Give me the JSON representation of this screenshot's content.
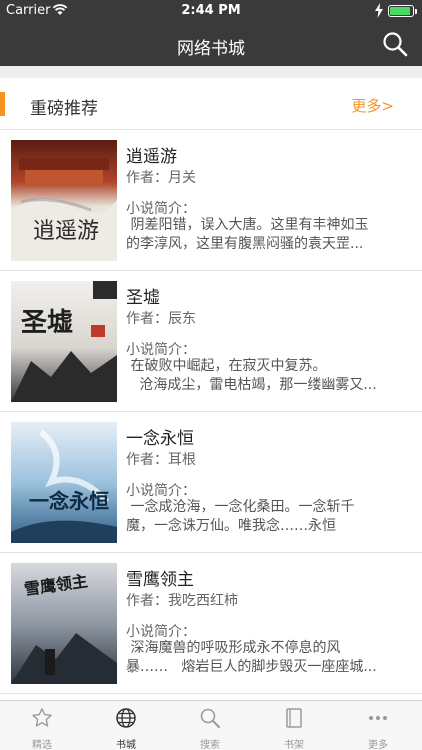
{
  "status_bar": {
    "carrier": "Carrier",
    "time": "2:44 PM",
    "battery_color": "#4cd964"
  },
  "nav": {
    "title": "网络书城",
    "search_icon": "search-icon"
  },
  "section": {
    "title": "重磅推荐",
    "more": "更多>",
    "accent_color": "#f7931e"
  },
  "books": [
    {
      "title": "逍遥游",
      "author": "作者：月关",
      "intro_label": "小说简介：",
      "intro": " 阴差阳错，误入大唐。这里有丰神如玉\n的李淳风，这里有腹黑闷骚的袁天罡...",
      "cover_text": "逍遥游"
    },
    {
      "title": "圣墟",
      "author": "作者：辰东",
      "intro_label": "小说简介：",
      "intro": " 在破败中崛起，在寂灭中复苏。\n   沧海成尘，雷电枯竭，那一缕幽雾又...",
      "cover_text": "圣墟"
    },
    {
      "title": "一念永恒",
      "author": "作者：耳根",
      "intro_label": "小说简介：",
      "intro": " 一念成沧海，一念化桑田。一念斩千\n魔，一念诛万仙。唯我念……永恒",
      "cover_text": "一念永恒"
    },
    {
      "title": "雪鹰领主",
      "author": "作者：我吃西红柿",
      "intro_label": "小说简介：",
      "intro": " 深海魔兽的呼吸形成永不停息的风\n暴……   熔岩巨人的脚步毁灭一座座城...",
      "cover_text": "雪鹰领主"
    }
  ],
  "tabs": [
    {
      "label": "精选",
      "icon": "star-icon",
      "active": false
    },
    {
      "label": "书城",
      "icon": "globe-icon",
      "active": true
    },
    {
      "label": "搜索",
      "icon": "search-icon",
      "active": false
    },
    {
      "label": "书架",
      "icon": "bookshelf-icon",
      "active": false
    },
    {
      "label": "更多",
      "icon": "more-icon",
      "active": false
    }
  ]
}
